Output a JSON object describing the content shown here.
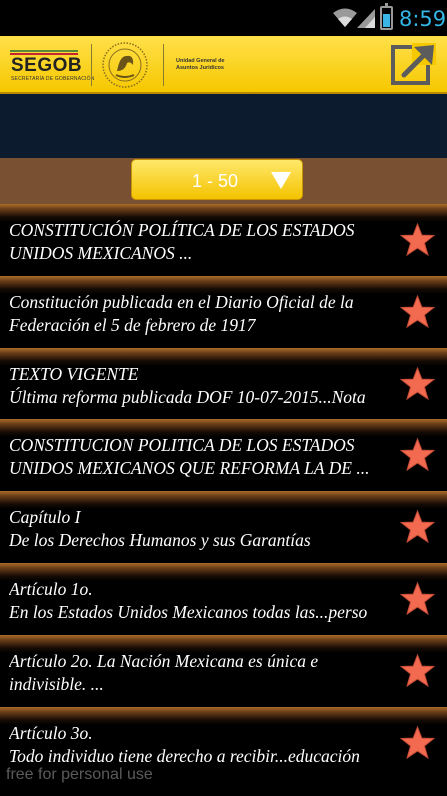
{
  "status_bar": {
    "time": "8:59",
    "time_color": "#33b5e5"
  },
  "header": {
    "logo_text": "SEGOB",
    "logo_subtext": "SECRETARÍA DE GOBERNACIÓN",
    "agency_line1": "Unidad General de",
    "agency_line2": "Asuntos Jurídicos",
    "exit_icon": "exit-arrow-icon"
  },
  "range_selector": {
    "label": "1 - 50"
  },
  "items": [
    {
      "line1": "CONSTITUCIÓN POLÍTICA DE LOS ESTADOS",
      "line2": "UNIDOS MEXICANOS ...",
      "line2_italic": true
    },
    {
      "line1": "Constitución publicada en el Diario Oficial de la",
      "line2": "Federación el 5 de febrero de 1917",
      "line2_italic": true
    },
    {
      "line1": "TEXTO VIGENTE",
      "line2": "Última reforma publicada DOF 10-07-2015...Nota",
      "line2_italic": true
    },
    {
      "line1": "CONSTITUCION POLITICA DE LOS ESTADOS",
      "line2": "UNIDOS MEXICANOS QUE REFORMA LA DE ...",
      "line2_italic": true
    },
    {
      "line1": "Capítulo I",
      "line2": "De los Derechos Humanos y sus Garantías",
      "line2_italic": true
    },
    {
      "line1": "Artículo 1o.",
      "line2": "En los Estados Unidos Mexicanos todas las...perso",
      "line2_italic": true
    },
    {
      "line1": "Artículo 2o. La Nación Mexicana es única e",
      "line2": "indivisible. ...",
      "line2_italic": true
    },
    {
      "line1": "Artículo 3o.",
      "line2": "Todo individuo tiene derecho a recibir...educación",
      "line2_italic": true
    }
  ],
  "watermark": "free for personal use",
  "colors": {
    "accent_yellow": "#f6c800",
    "star": "#f26a50",
    "row_bg": "#000000"
  }
}
